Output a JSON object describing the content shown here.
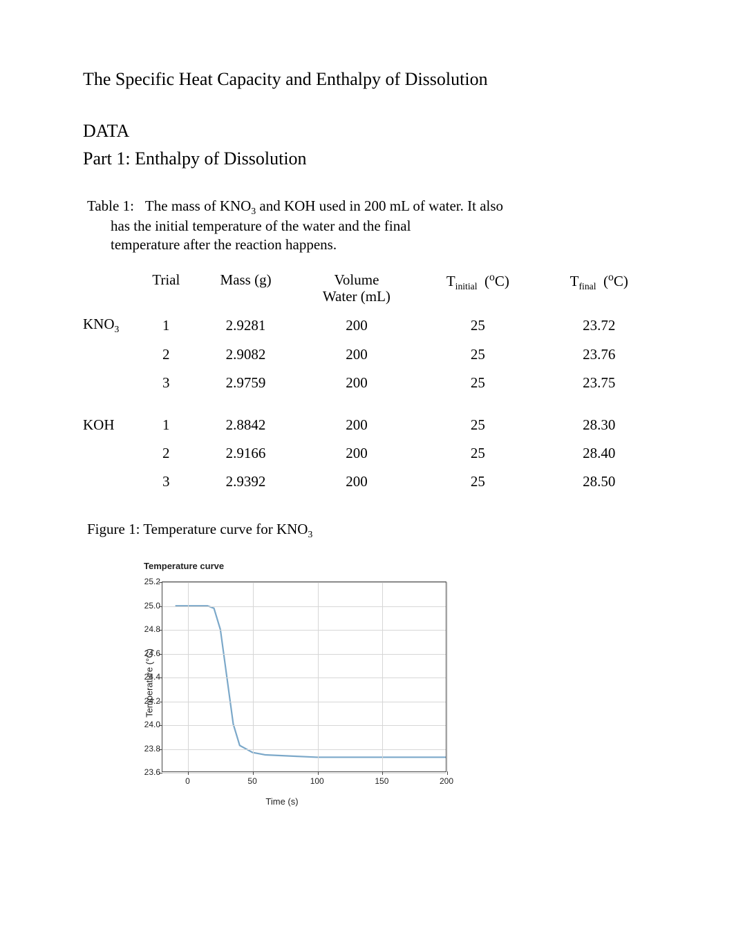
{
  "title": "The Specific Heat Capacity and Enthalpy of Dissolution",
  "section1": "DATA",
  "subsection1": "Part 1: Enthalpy of Dissolution",
  "table1": {
    "caption_label": "Table 1:",
    "caption_l1a": "The mass of KNO",
    "caption_l1b": " and KOH used in 200 mL of water. It also",
    "caption_l2": "has the initial temperature of the water and the final",
    "caption_l3": "temperature after the reaction happens.",
    "headers": {
      "trial": "Trial",
      "mass": "Mass (g)",
      "volume_l1": "Volume",
      "volume_l2": "Water (mL)",
      "tinitial_pre": "T",
      "tinitial_sub": "initial",
      "tinitial_unit": "C)",
      "tfinal_pre": "T",
      "tfinal_sub": "final",
      "tfinal_unit": "C)"
    },
    "groups": [
      {
        "label_pre": "KNO",
        "label_sub": "3",
        "rows": [
          {
            "trial": "1",
            "mass": "2.9281",
            "vol": "200",
            "ti": "25",
            "tf": "23.72"
          },
          {
            "trial": "2",
            "mass": "2.9082",
            "vol": "200",
            "ti": "25",
            "tf": "23.76"
          },
          {
            "trial": "3",
            "mass": "2.9759",
            "vol": "200",
            "ti": "25",
            "tf": "23.75"
          }
        ]
      },
      {
        "label_pre": "KOH",
        "label_sub": "",
        "rows": [
          {
            "trial": "1",
            "mass": "2.8842",
            "vol": "200",
            "ti": "25",
            "tf": "28.30"
          },
          {
            "trial": "2",
            "mass": "2.9166",
            "vol": "200",
            "ti": "25",
            "tf": "28.40"
          },
          {
            "trial": "3",
            "mass": "2.9392",
            "vol": "200",
            "ti": "25",
            "tf": "28.50"
          }
        ]
      }
    ]
  },
  "figure1": {
    "caption_pre": "Figure 1: Temperature curve for KNO",
    "caption_sub": "3"
  },
  "chart_data": {
    "type": "line",
    "title": "Temperature curve",
    "xlabel": "Time (s)",
    "ylabel": "Temperature (°C)",
    "xlim": [
      -20,
      200
    ],
    "ylim": [
      23.6,
      25.2
    ],
    "xticks": [
      0,
      50,
      100,
      150,
      200
    ],
    "yticks": [
      23.6,
      23.8,
      24.0,
      24.2,
      24.4,
      24.6,
      24.8,
      25.0,
      25.2
    ],
    "series": [
      {
        "name": "KNO3",
        "color": "#7ba8c9",
        "x": [
          -10,
          0,
          5,
          10,
          15,
          20,
          25,
          30,
          35,
          40,
          50,
          60,
          80,
          100,
          130,
          160,
          200
        ],
        "y": [
          25.0,
          25.0,
          25.0,
          25.0,
          25.0,
          24.98,
          24.8,
          24.4,
          24.0,
          23.82,
          23.76,
          23.74,
          23.73,
          23.72,
          23.72,
          23.72,
          23.72
        ]
      }
    ]
  }
}
